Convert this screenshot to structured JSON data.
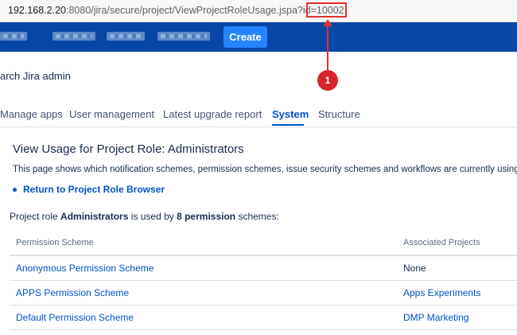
{
  "browser": {
    "url_host": "192.168.2.20",
    "url_path": ":8080/jira/secure/project/ViewProjectRoleUsage.jspa?id=10002"
  },
  "topnav": {
    "create_label": "Create"
  },
  "header": {
    "search_admin": "arch Jira admin"
  },
  "tabs": [
    {
      "label": "Manage apps"
    },
    {
      "label": "User management"
    },
    {
      "label": "Latest upgrade report"
    },
    {
      "label": "System"
    },
    {
      "label": "Structure"
    }
  ],
  "main": {
    "title": "View Usage for Project Role: Administrators",
    "intro": "This page shows which notification schemes, permission schemes, issue security schemes and workflows are currently using th",
    "back_link": "Return to Project Role Browser",
    "summary": {
      "prefix": "Project role ",
      "role": "Administrators",
      "middle": " is used by ",
      "count": "8 permission",
      "suffix": " schemes:"
    },
    "table": {
      "headers": [
        "Permission Scheme",
        "Associated Projects"
      ],
      "rows": [
        {
          "scheme": "Anonymous Permission Scheme",
          "project": "None"
        },
        {
          "scheme": "APPS Permission Scheme",
          "project": "Apps Experiments"
        },
        {
          "scheme": "Default Permission Scheme",
          "project": "DMP Marketing"
        }
      ]
    }
  },
  "annotation": {
    "badge": "1"
  },
  "colors": {
    "nav": "#0747a6",
    "accent": "#0052cc",
    "create": "#2684ff",
    "annotation": "#e0312f"
  }
}
